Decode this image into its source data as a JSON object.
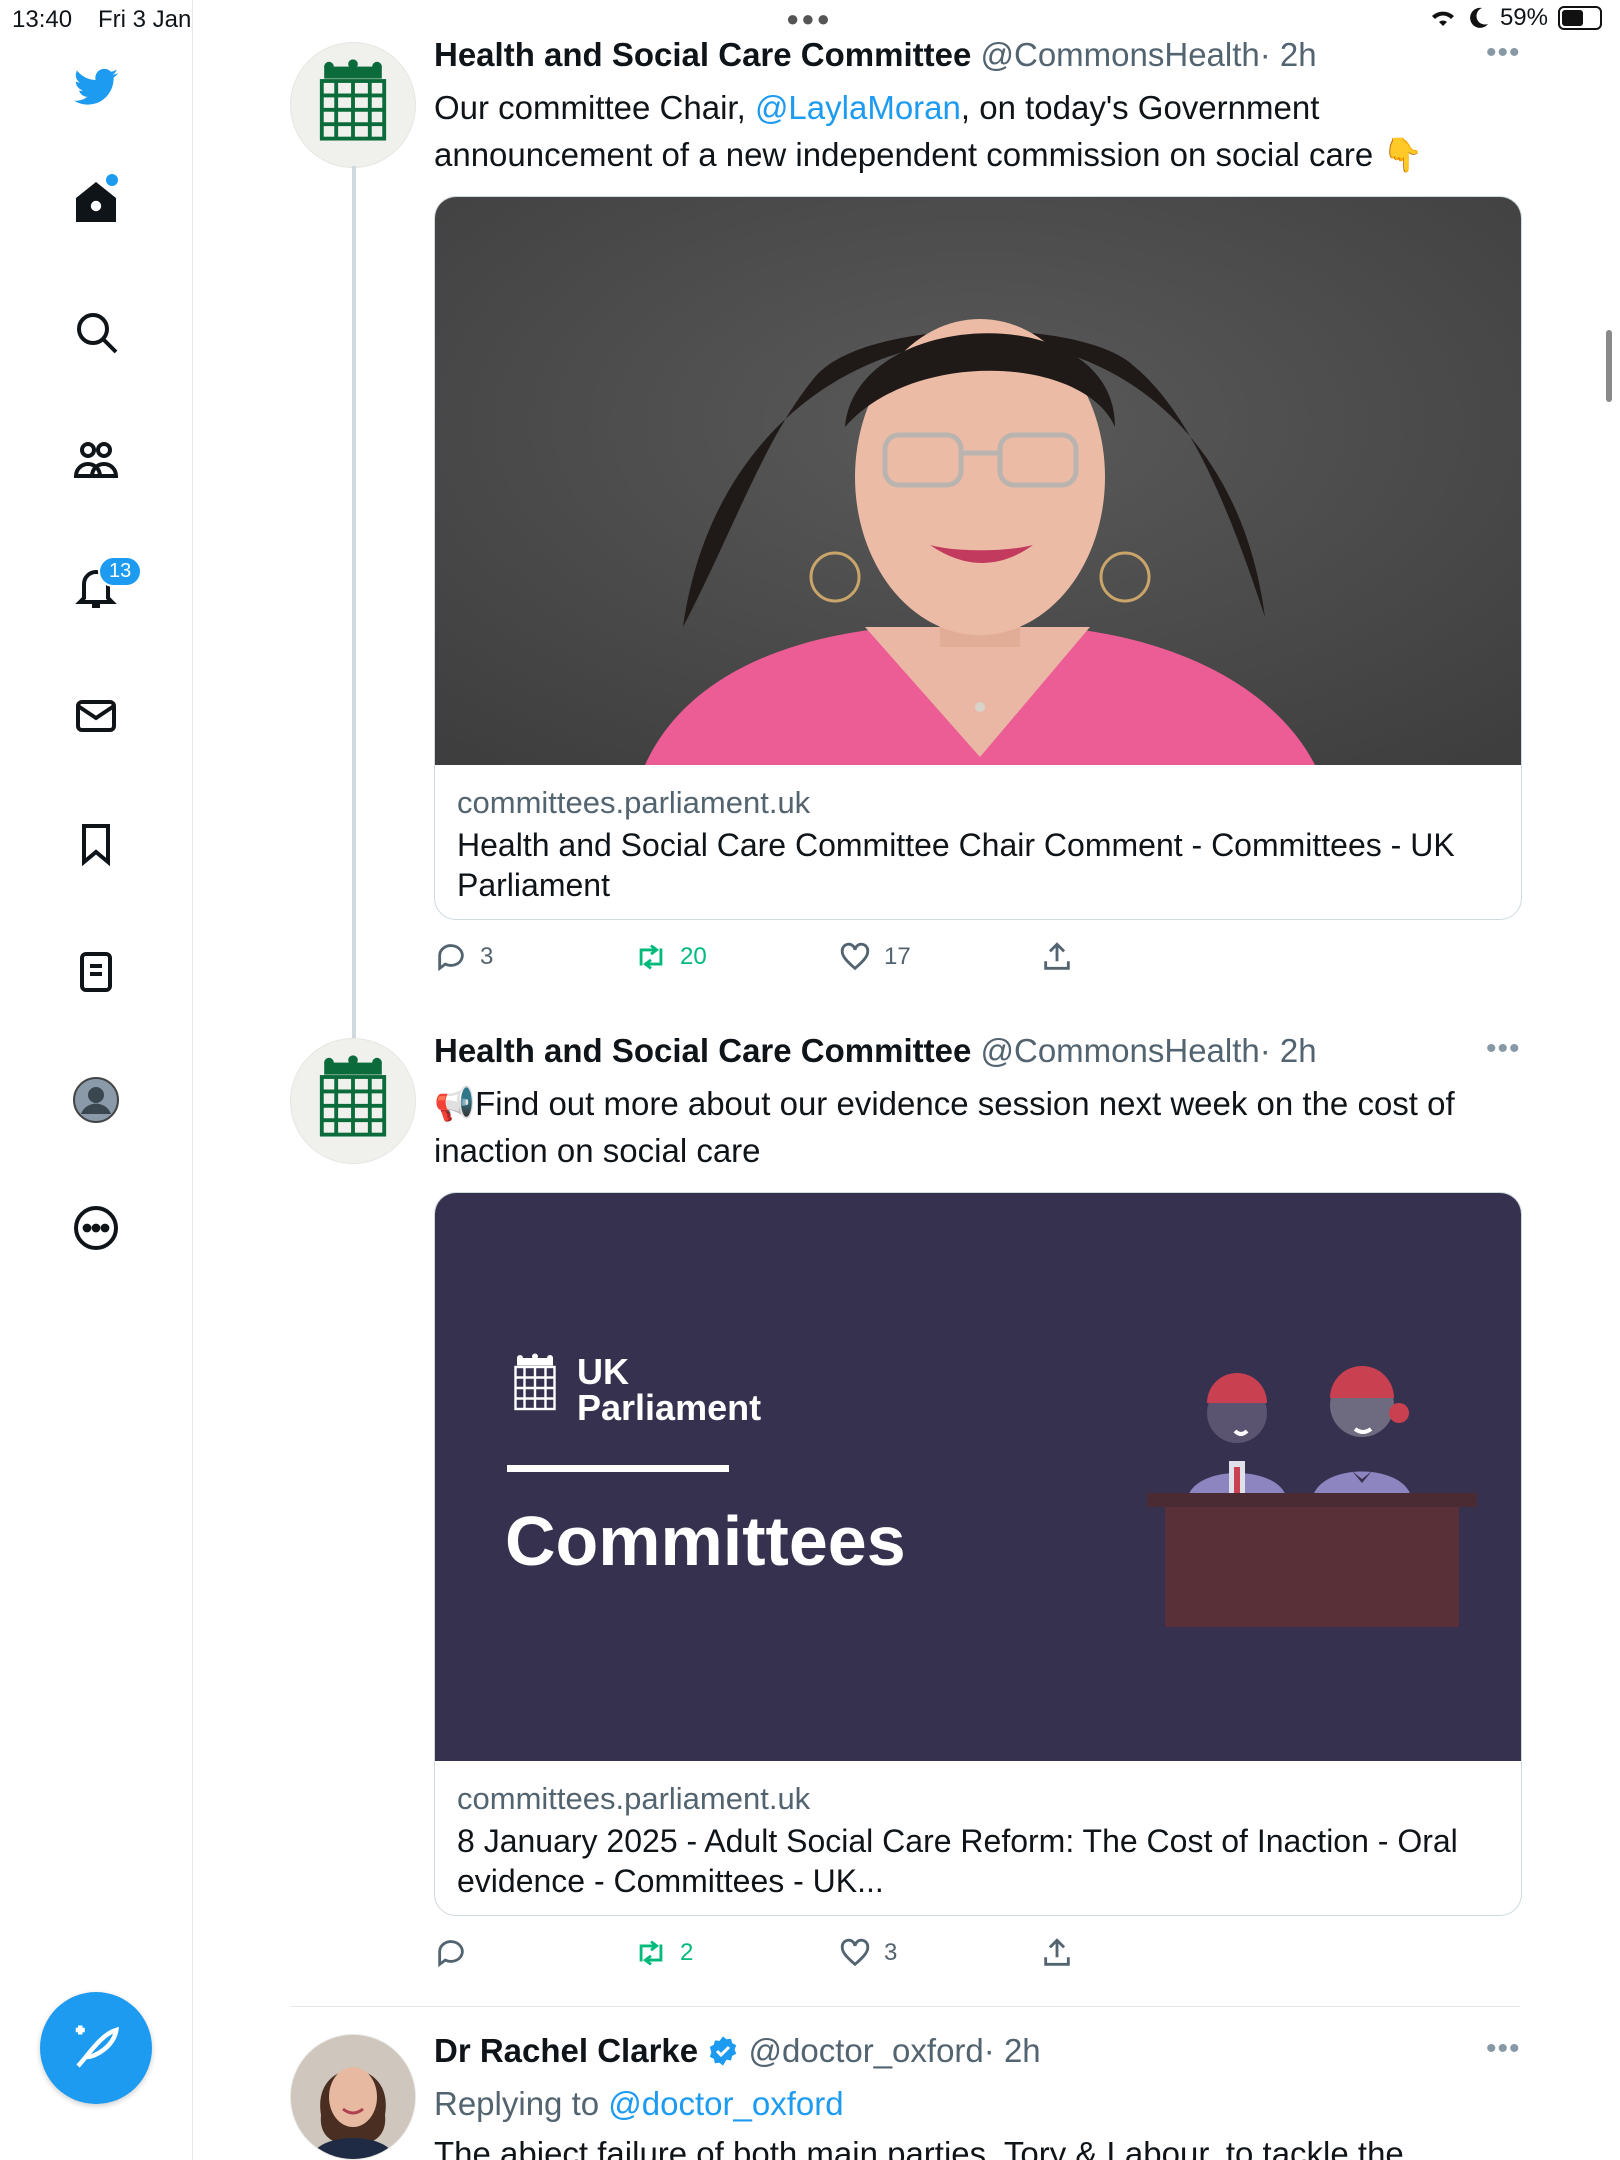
{
  "status_bar": {
    "time": "13:40",
    "date": "Fri 3 Jan",
    "battery": "59%",
    "battery_level": 0.59
  },
  "sidebar": {
    "notification_count": "13",
    "items": [
      "home-icon",
      "search-icon",
      "communities-icon",
      "notifications-icon",
      "messages-icon",
      "bookmarks-icon",
      "lists-icon",
      "profile-icon",
      "more-icon"
    ]
  },
  "tweets": [
    {
      "name": "Health and Social Care Committee",
      "handle": "@CommonsHealth",
      "time": "· 2h",
      "text_prefix": "Our committee Chair, ",
      "mention": "@LaylaMoran",
      "text_suffix": ", on today's Government announcement of a new independent commission on social care 👇",
      "card": {
        "domain": "committees.parliament.uk",
        "title": "Health and Social Care Committee Chair Comment - Committees - UK Parliament"
      },
      "replies": "3",
      "retweets": "20",
      "likes": "17"
    },
    {
      "name": "Health and Social Care Committee",
      "handle": "@CommonsHealth",
      "time": "· 2h",
      "text": "📢Find out more about our evidence session next week on the cost of inaction on social care",
      "card": {
        "banner_top": "UK",
        "banner_bottom": "Parliament",
        "banner_title": "Committees",
        "domain": "committees.parliament.uk",
        "title": "8 January 2025 - Adult Social Care Reform: The Cost of Inaction - Oral evidence - Committees - UK..."
      },
      "replies": "",
      "retweets": "2",
      "likes": "3"
    },
    {
      "name": "Dr Rachel Clarke",
      "handle": "@doctor_oxford",
      "time": "· 2h",
      "replying_prefix": "Replying to ",
      "replying_to": "@doctor_oxford",
      "text": "The abject failure of both main parties, Tory & Labour, to tackle the"
    }
  ],
  "colors": {
    "accent": "#1d9bf0",
    "retweet": "#00ba7c",
    "banner_bg": "#373150"
  }
}
